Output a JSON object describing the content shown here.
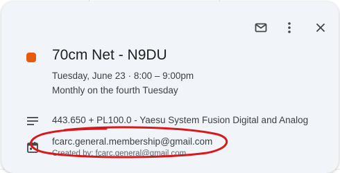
{
  "event": {
    "title": "70cm Net - N9DU",
    "color": "#e8590c",
    "datetime": "Tuesday, June 23  ·  8:00 – 9:00pm",
    "recurrence": "Monthly on the fourth Tuesday",
    "description": "443.650 + PL100.0 - Yaesu System Fusion Digital and Analog",
    "calendar": "fcarc.general.membership@gmail.com",
    "created_by": "Created by: fcarc.general@gmail.com"
  },
  "toolbar": {
    "icons": [
      "mail-icon",
      "more-vert-icon",
      "close-icon"
    ]
  },
  "annotation": {
    "color": "#d7191c"
  }
}
